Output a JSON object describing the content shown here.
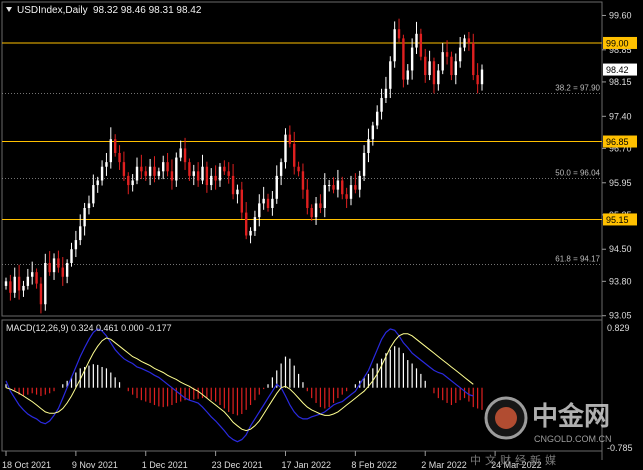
{
  "header": {
    "symbol_text": "USDIndex,Daily",
    "ohlc_text": "98.32 98.46 98.31 98.42",
    "macd_text": "MACD(12,26,9) 0.324 0.461 0.000 -0.177"
  },
  "colors": {
    "background": "#000000",
    "bull": "#ffffff",
    "bear": "#e02020",
    "level_line": "#ffc000",
    "fib_line": "#9a9a9a",
    "macd_line": "#2a2ae0",
    "signal_line": "#ffff90",
    "histo_pos": "#ffffff",
    "histo_neg": "#e02020"
  },
  "chart_data": {
    "type": "candlestick",
    "price_axis": {
      "ticks": [
        99.6,
        98.85,
        98.15,
        97.4,
        96.7,
        95.95,
        95.25,
        94.5,
        93.8,
        93.05
      ],
      "tick_labels": [
        "99.60",
        "98.85",
        "98.15",
        "97.40",
        "96.70",
        "95.95",
        "95.25",
        "94.50",
        "93.80",
        "93.05"
      ],
      "range": [
        93.0,
        99.85
      ]
    },
    "macd_axis": {
      "labels": [
        "0.829",
        "-0.785"
      ],
      "range": [
        -0.9,
        0.95
      ]
    },
    "date_labels": [
      "18 Oct 2021",
      "9 Nov 2021",
      "1 Dec 2021",
      "23 Dec 2021",
      "17 Jan 2022",
      "8 Feb 2022",
      "2 Mar 2022",
      "24 Mar 2022"
    ],
    "date_label_index": [
      0,
      16,
      32,
      48,
      64,
      80,
      96,
      112
    ],
    "level_lines": [
      {
        "value": 99.0,
        "label": "99.00"
      },
      {
        "value": 96.85,
        "label": "96.85"
      },
      {
        "value": 95.15,
        "label": "95.15"
      }
    ],
    "fib_lines": [
      {
        "value": 97.9,
        "label": "38.2 = 97.90"
      },
      {
        "value": 96.04,
        "label": "50.0 = 96.04"
      },
      {
        "value": 94.17,
        "label": "61.8 = 94.17"
      }
    ],
    "current_price": {
      "value": 98.42,
      "label": "98.42"
    },
    "closes": [
      93.8,
      93.55,
      93.9,
      93.6,
      93.7,
      93.9,
      94.0,
      93.75,
      93.3,
      94.2,
      94.0,
      94.3,
      94.1,
      93.9,
      94.2,
      94.5,
      94.7,
      95.0,
      95.4,
      95.5,
      95.9,
      96.0,
      96.3,
      96.4,
      96.9,
      96.6,
      96.4,
      96.1,
      95.9,
      96.0,
      96.3,
      96.2,
      96.1,
      96.3,
      96.1,
      96.2,
      96.4,
      96.2,
      96.0,
      96.5,
      96.7,
      96.4,
      96.1,
      96.2,
      96.0,
      96.3,
      95.9,
      96.1,
      96.0,
      96.3,
      96.2,
      96.1,
      95.7,
      95.8,
      95.3,
      94.8,
      94.9,
      95.2,
      95.5,
      95.6,
      95.4,
      95.6,
      96.1,
      96.4,
      97.0,
      96.8,
      96.3,
      96.2,
      95.8,
      95.4,
      95.2,
      95.5,
      95.4,
      95.9,
      95.9,
      95.8,
      96.0,
      95.7,
      95.6,
      95.9,
      95.8,
      96.1,
      96.6,
      96.9,
      97.2,
      97.5,
      97.8,
      98.0,
      98.6,
      99.3,
      99.1,
      98.2,
      98.4,
      98.9,
      99.2,
      98.7,
      98.3,
      98.6,
      98.1,
      98.4,
      98.8,
      98.7,
      98.3,
      98.6,
      98.9,
      99.1,
      99.0,
      98.3,
      98.1,
      98.42
    ],
    "macd_hist": [
      0.05,
      0.0,
      -0.05,
      -0.1,
      -0.12,
      -0.1,
      -0.08,
      -0.1,
      -0.12,
      -0.1,
      -0.08,
      -0.05,
      0.0,
      0.05,
      0.1,
      0.15,
      0.22,
      0.28,
      0.3,
      0.32,
      0.34,
      0.33,
      0.3,
      0.28,
      0.22,
      0.15,
      0.08,
      0.0,
      -0.05,
      -0.1,
      -0.15,
      -0.18,
      -0.2,
      -0.22,
      -0.25,
      -0.27,
      -0.28,
      -0.27,
      -0.25,
      -0.22,
      -0.2,
      -0.18,
      -0.18,
      -0.17,
      -0.16,
      -0.15,
      -0.15,
      -0.18,
      -0.2,
      -0.25,
      -0.3,
      -0.35,
      -0.38,
      -0.4,
      -0.38,
      -0.32,
      -0.25,
      -0.18,
      -0.1,
      -0.02,
      0.05,
      0.15,
      0.25,
      0.35,
      0.45,
      0.42,
      0.32,
      0.2,
      0.08,
      -0.05,
      -0.15,
      -0.22,
      -0.28,
      -0.3,
      -0.28,
      -0.22,
      -0.15,
      -0.1,
      -0.05,
      0.0,
      0.05,
      0.1,
      0.15,
      0.2,
      0.28,
      0.35,
      0.42,
      0.5,
      0.55,
      0.6,
      0.58,
      0.5,
      0.4,
      0.35,
      0.28,
      0.2,
      0.1,
      0.0,
      -0.08,
      -0.15,
      -0.18,
      -0.22,
      -0.25,
      -0.22,
      -0.18,
      -0.15,
      -0.2,
      -0.28,
      -0.3,
      -0.32
    ],
    "macd_line": [
      0.1,
      -0.05,
      -0.15,
      -0.25,
      -0.32,
      -0.38,
      -0.42,
      -0.45,
      -0.5,
      -0.52,
      -0.48,
      -0.4,
      -0.3,
      -0.15,
      0.0,
      0.15,
      0.3,
      0.45,
      0.58,
      0.7,
      0.8,
      0.85,
      0.82,
      0.75,
      0.65,
      0.55,
      0.48,
      0.42,
      0.38,
      0.35,
      0.3,
      0.28,
      0.25,
      0.22,
      0.18,
      0.15,
      0.1,
      0.05,
      0.0,
      -0.05,
      -0.1,
      -0.15,
      -0.18,
      -0.2,
      -0.22,
      -0.28,
      -0.35,
      -0.42,
      -0.48,
      -0.55,
      -0.62,
      -0.7,
      -0.75,
      -0.78,
      -0.75,
      -0.68,
      -0.55,
      -0.45,
      -0.35,
      -0.25,
      -0.15,
      -0.05,
      0.05,
      0.0,
      -0.12,
      -0.25,
      -0.35,
      -0.42,
      -0.45,
      -0.45,
      -0.42,
      -0.4,
      -0.38,
      -0.35,
      -0.3,
      -0.25,
      -0.22,
      -0.2,
      -0.15,
      -0.1,
      -0.05,
      0.05,
      0.15,
      0.25,
      0.4,
      0.55,
      0.7,
      0.8,
      0.85,
      0.83,
      0.75,
      0.65,
      0.58,
      0.5,
      0.45,
      0.4,
      0.35,
      0.3,
      0.25,
      0.22,
      0.2,
      0.15,
      0.1,
      0.05,
      0.0,
      -0.05,
      -0.1,
      -0.12
    ],
    "signal_line": [
      0.0,
      -0.02,
      -0.05,
      -0.08,
      -0.12,
      -0.16,
      -0.2,
      -0.25,
      -0.3,
      -0.35,
      -0.37,
      -0.37,
      -0.35,
      -0.3,
      -0.22,
      -0.12,
      0.0,
      0.12,
      0.25,
      0.38,
      0.5,
      0.6,
      0.68,
      0.72,
      0.7,
      0.65,
      0.6,
      0.55,
      0.5,
      0.45,
      0.42,
      0.38,
      0.35,
      0.32,
      0.28,
      0.25,
      0.22,
      0.18,
      0.15,
      0.12,
      0.08,
      0.05,
      0.02,
      -0.02,
      -0.05,
      -0.1,
      -0.15,
      -0.2,
      -0.25,
      -0.3,
      -0.35,
      -0.42,
      -0.5,
      -0.55,
      -0.6,
      -0.62,
      -0.6,
      -0.55,
      -0.48,
      -0.38,
      -0.28,
      -0.18,
      -0.08,
      0.0,
      0.02,
      -0.02,
      -0.08,
      -0.15,
      -0.22,
      -0.28,
      -0.32,
      -0.35,
      -0.38,
      -0.4,
      -0.4,
      -0.38,
      -0.35,
      -0.3,
      -0.25,
      -0.2,
      -0.15,
      -0.1,
      -0.05,
      0.02,
      0.1,
      0.2,
      0.32,
      0.45,
      0.58,
      0.68,
      0.75,
      0.78,
      0.78,
      0.75,
      0.7,
      0.65,
      0.6,
      0.55,
      0.5,
      0.45,
      0.4,
      0.35,
      0.3,
      0.25,
      0.2,
      0.15,
      0.1,
      0.05
    ]
  },
  "watermark": {
    "brand_cn": "中金网",
    "brand_en": "CNGOLD.COM.CN",
    "tagline_cn": "中文财经新媒"
  }
}
